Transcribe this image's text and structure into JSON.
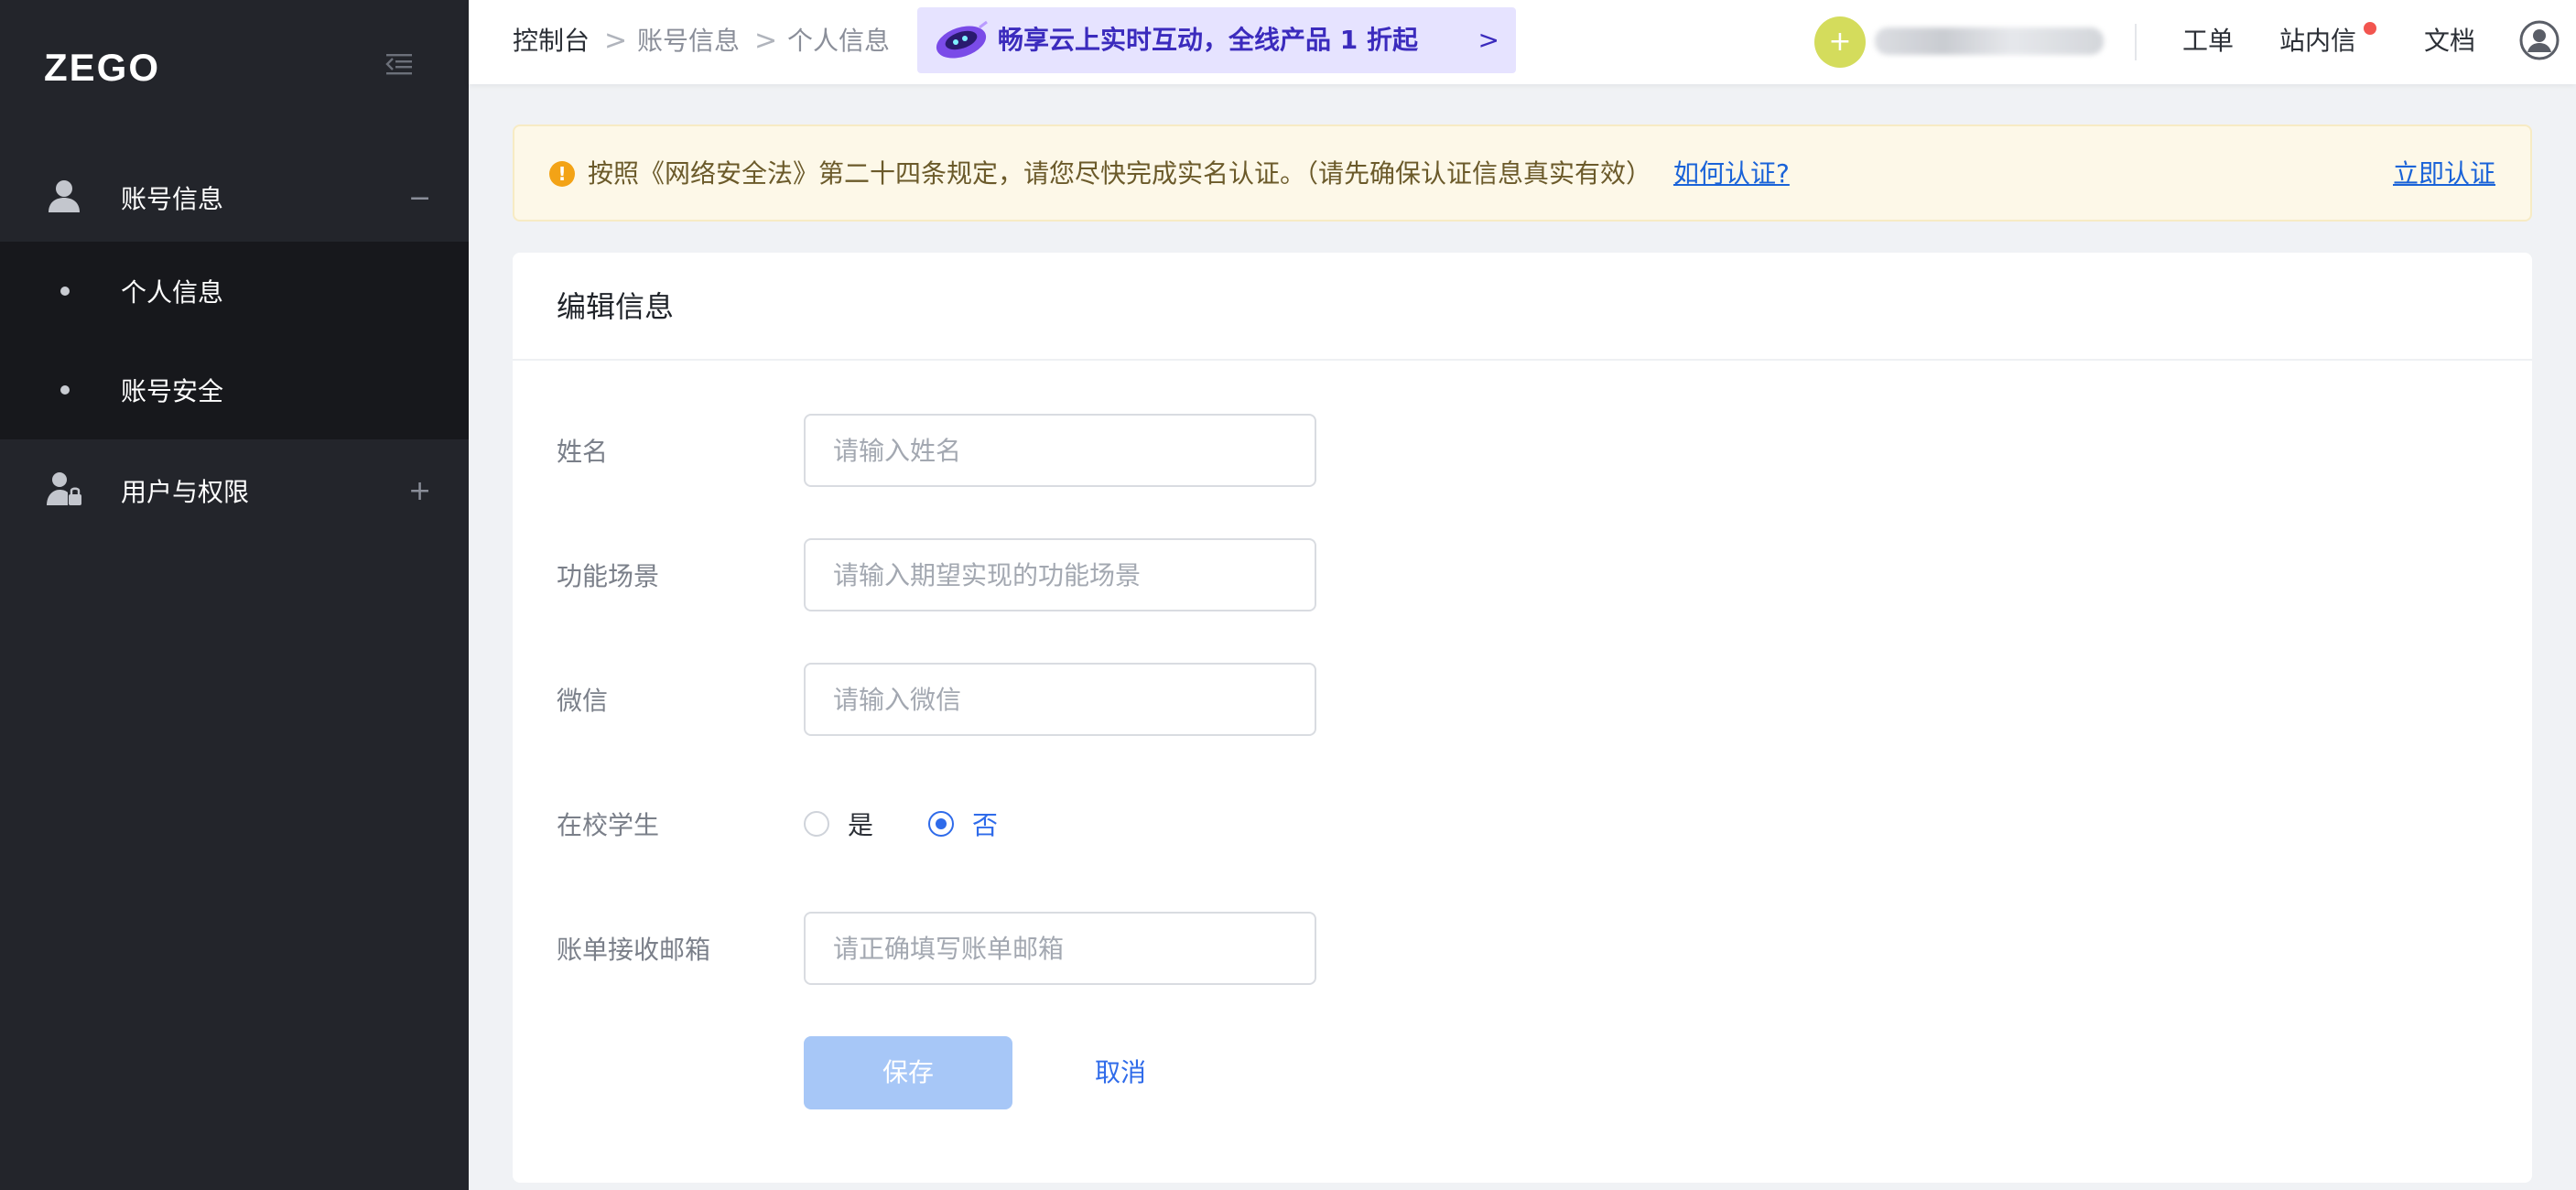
{
  "brand": {
    "logo_text": "ZEGO"
  },
  "sidebar": {
    "groups": [
      {
        "label": "账号信息",
        "toggle": "−",
        "icon": "user-icon",
        "expanded": true
      },
      {
        "label": "用户与权限",
        "toggle": "+",
        "icon": "user-lock-icon",
        "expanded": false
      }
    ],
    "subitems": [
      {
        "label": "个人信息",
        "active": true
      },
      {
        "label": "账号安全",
        "active": false
      }
    ]
  },
  "header": {
    "breadcrumb": [
      "控制台",
      "账号信息",
      "个人信息"
    ],
    "breadcrumb_sep": ">",
    "promo": {
      "text": "畅享云上实时互动，全线产品 1 折起",
      "arrow": ">"
    },
    "add_button": "+",
    "links": {
      "ticket": "工单",
      "inbox": "站内信",
      "docs": "文档"
    },
    "inbox_has_unread": true
  },
  "notice": {
    "text": "按照《网络安全法》第二十四条规定，请您尽快完成实名认证。（请先确保认证信息真实有效）",
    "help_link": "如何认证?",
    "action": "立即认证"
  },
  "form": {
    "title": "编辑信息",
    "fields": {
      "name": {
        "label": "姓名",
        "placeholder": "请输入姓名",
        "value": ""
      },
      "scenario": {
        "label": "功能场景",
        "placeholder": "请输入期望实现的功能场景",
        "value": ""
      },
      "wechat": {
        "label": "微信",
        "placeholder": "请输入微信",
        "value": ""
      },
      "student": {
        "label": "在校学生",
        "options": [
          "是",
          "否"
        ],
        "selected": "否"
      },
      "email": {
        "label": "账单接收邮箱",
        "placeholder": "请正确填写账单邮箱",
        "value": ""
      }
    },
    "save_label": "保存",
    "cancel_label": "取消"
  },
  "colors": {
    "sidebar_bg": "#23252b",
    "submenu_bg": "#17181c",
    "accent": "#2f6bea",
    "save_disabled": "#a7c7f7",
    "promo_bg": "#e6e3ff",
    "notice_bg": "#fdf8e8",
    "warning": "#f3a316",
    "badge_red": "#f2554f"
  }
}
